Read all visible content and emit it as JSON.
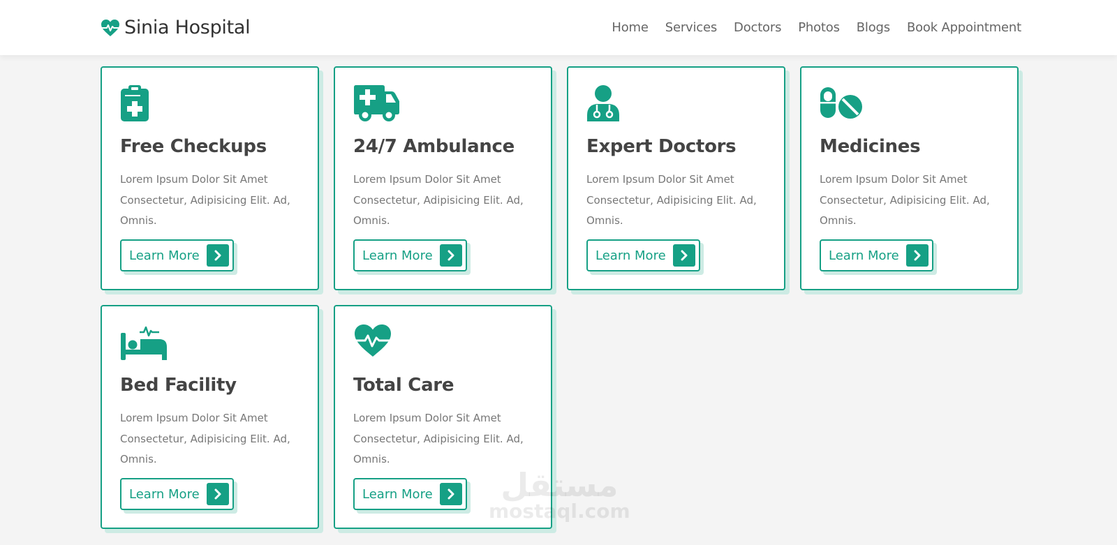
{
  "brand": {
    "name": "Sinia Hospital",
    "icon": "heartbeat-icon",
    "accent": "#16a085",
    "shadow": "#cdebe4"
  },
  "nav": {
    "items": [
      {
        "label": "Home"
      },
      {
        "label": "Services"
      },
      {
        "label": "Doctors"
      },
      {
        "label": "Photos"
      },
      {
        "label": "Blogs"
      },
      {
        "label": "Book Appointment"
      }
    ]
  },
  "services": [
    {
      "icon": "clipboard-medical-icon",
      "title": "Free Checkups",
      "text": "Lorem Ipsum Dolor Sit Amet Consectetur, Adipisicing Elit. Ad, Omnis.",
      "button": "Learn More"
    },
    {
      "icon": "ambulance-icon",
      "title": "24/7 Ambulance",
      "text": "Lorem Ipsum Dolor Sit Amet Consectetur, Adipisicing Elit. Ad, Omnis.",
      "button": "Learn More"
    },
    {
      "icon": "doctor-icon",
      "title": "Expert Doctors",
      "text": "Lorem Ipsum Dolor Sit Amet Consectetur, Adipisicing Elit. Ad, Omnis.",
      "button": "Learn More"
    },
    {
      "icon": "pills-icon",
      "title": "Medicines",
      "text": "Lorem Ipsum Dolor Sit Amet Consectetur, Adipisicing Elit. Ad, Omnis.",
      "button": "Learn More"
    },
    {
      "icon": "bed-icon",
      "title": "Bed Facility",
      "text": "Lorem Ipsum Dolor Sit Amet Consectetur, Adipisicing Elit. Ad, Omnis.",
      "button": "Learn More"
    },
    {
      "icon": "heartbeat-icon",
      "title": "Total Care",
      "text": "Lorem Ipsum Dolor Sit Amet Consectetur, Adipisicing Elit. Ad, Omnis.",
      "button": "Learn More"
    }
  ],
  "watermark": {
    "arabic": "مستقل",
    "latin": "mostaql.com"
  }
}
